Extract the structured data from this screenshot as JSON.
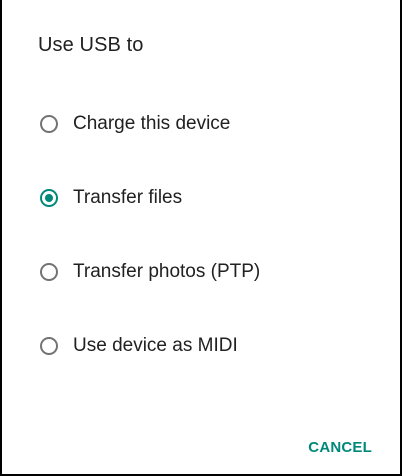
{
  "dialog": {
    "title": "Use USB to",
    "options": [
      {
        "label": "Charge this device",
        "checked": false
      },
      {
        "label": "Transfer files",
        "checked": true
      },
      {
        "label": "Transfer photos (PTP)",
        "checked": false
      },
      {
        "label": "Use device as MIDI",
        "checked": false
      }
    ],
    "cancel_label": "CANCEL"
  },
  "colors": {
    "accent": "#00897b",
    "text": "#212121",
    "radio_unchecked": "#737373"
  },
  "icons": {
    "radio_unchecked": "radio-unchecked-icon",
    "radio_checked": "radio-checked-icon"
  }
}
